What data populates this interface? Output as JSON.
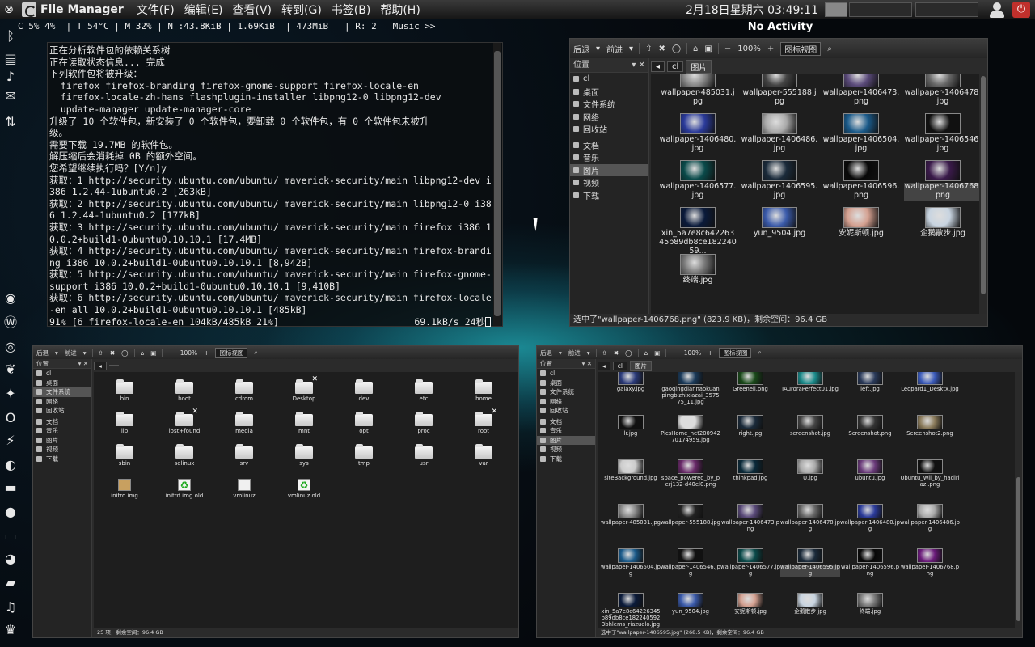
{
  "top_panel": {
    "app_title": "File Manager",
    "menus": [
      "文件(F)",
      "编辑(E)",
      "查看(V)",
      "转到(G)",
      "书签(B)",
      "帮助(H)"
    ],
    "clock": "2月18日星期六 03:49:11"
  },
  "conky": "C 5% 4%  | T 54°C | M 32% | N :43.8KiB | 1.69KiB  | 473MiB   | R: 2   Music >>",
  "now_playing": "No Activity",
  "dock_icons": [
    "bluetooth-icon",
    "network-icon",
    "volume-icon",
    "mail-icon",
    "transfer-icon",
    "firefox-icon",
    "wordpress-icon",
    "chrome-icon",
    "butterfly-icon",
    "star-icon",
    "opera-icon",
    "lightning-icon",
    "fox-icon",
    "clapper-icon",
    "chat-icon",
    "monitor-icon",
    "terminal-icon",
    "folder-icon",
    "music-icon",
    "tooth-icon"
  ],
  "terminal": {
    "lines": [
      "正在分析软件包的依赖关系树",
      "正在读取状态信息... 完成",
      "下列软件包将被升级：",
      "  firefox firefox-branding firefox-gnome-support firefox-locale-en",
      "  firefox-locale-zh-hans flashplugin-installer libpng12-0 libpng12-dev",
      "  update-manager update-manager-core",
      "升级了 10 个软件包，新安装了 0 个软件包，要卸载 0 个软件包，有 0 个软件包未被升",
      "级。",
      "需要下载 19.7MB 的软件包。",
      "解压缩后会消耗掉 0B 的额外空间。",
      "您希望继续执行吗？[Y/n]y",
      "获取：1 http://security.ubuntu.com/ubuntu/ maverick-security/main libpng12-dev i",
      "386 1.2.44-1ubuntu0.2 [263kB]",
      "获取：2 http://security.ubuntu.com/ubuntu/ maverick-security/main libpng12-0 i38",
      "6 1.2.44-1ubuntu0.2 [177kB]",
      "获取：3 http://security.ubuntu.com/ubuntu/ maverick-security/main firefox i386 1",
      "0.0.2+build1-0ubuntu0.10.10.1 [17.4MB]",
      "获取：4 http://security.ubuntu.com/ubuntu/ maverick-security/main firefox-brandi",
      "ng i386 10.0.2+build1-0ubuntu0.10.10.1 [8,942B]",
      "获取：5 http://security.ubuntu.com/ubuntu/ maverick-security/main firefox-gnome-",
      "support i386 10.0.2+build1-0ubuntu0.10.10.1 [9,410B]",
      "获取：6 http://security.ubuntu.com/ubuntu/ maverick-security/main firefox-locale",
      "-en all 10.0.2+build1-0ubuntu0.10.10.1 [485kB]"
    ],
    "progress_left": "91% [6 firefox-locale-en 104kB/485kB 21%]",
    "progress_right": "69.1kB/s 24秒"
  },
  "toolbar": {
    "back": "后退",
    "forward": "前进",
    "zoom": "100%",
    "view_mode": "图标视图"
  },
  "sidebar": {
    "header": "位置",
    "items": [
      "cl",
      "桌面",
      "文件系统",
      "网络",
      "回收站",
      "文档",
      "音乐",
      "图片",
      "视频",
      "下载"
    ]
  },
  "fm1": {
    "crumbs": [
      "cl",
      "图片"
    ],
    "files": [
      {
        "name": "wallpaper-485031.jpg",
        "color": "#888"
      },
      {
        "name": "wallpaper-555188.jpg",
        "color": "#444"
      },
      {
        "name": "wallpaper-1406473.png",
        "color": "#5a4a7a"
      },
      {
        "name": "wallpaper-1406478.jpg",
        "color": "#666"
      },
      {
        "name": "wallpaper-1406480.jpg",
        "color": "#2a3a9a"
      },
      {
        "name": "wallpaper-1406486.jpg",
        "color": "#aaa"
      },
      {
        "name": "wallpaper-1406504.jpg",
        "color": "#1a5a8a"
      },
      {
        "name": "wallpaper-1406546.jpg",
        "color": "#111"
      },
      {
        "name": "wallpaper-1406577.jpg",
        "color": "#0a4a4a"
      },
      {
        "name": "wallpaper-1406595.jpg",
        "color": "#1a2a3a"
      },
      {
        "name": "wallpaper-1406596.png",
        "color": "#080808"
      },
      {
        "name": "wallpaper-1406768.png",
        "color": "#3a1a4a"
      },
      {
        "name": "xin_5a7e8c64226345b89db8ce18224059...",
        "color": "#0a1a3a"
      },
      {
        "name": "yun_9504.jpg",
        "color": "#3a5aaa"
      },
      {
        "name": "安妮斯顿.jpg",
        "color": "#d4a090"
      },
      {
        "name": "企鹅散步.jpg",
        "color": "#c8d4e0"
      },
      {
        "name": "终端.jpg",
        "color": "#777"
      }
    ],
    "status": "选中了\"wallpaper-1406768.png\" (823.9 KB)，剩余空间：96.4 GB"
  },
  "fm2": {
    "crumbs": [
      ""
    ],
    "files": [
      {
        "name": "bin",
        "type": "folder"
      },
      {
        "name": "boot",
        "type": "folder"
      },
      {
        "name": "cdrom",
        "type": "folder"
      },
      {
        "name": "Desktop",
        "type": "folder",
        "badge": "✕"
      },
      {
        "name": "dev",
        "type": "folder"
      },
      {
        "name": "etc",
        "type": "folder"
      },
      {
        "name": "home",
        "type": "folder"
      },
      {
        "name": "lib",
        "type": "folder"
      },
      {
        "name": "lost+found",
        "type": "folder",
        "badge": "✕"
      },
      {
        "name": "media",
        "type": "folder"
      },
      {
        "name": "mnt",
        "type": "folder"
      },
      {
        "name": "opt",
        "type": "folder"
      },
      {
        "name": "proc",
        "type": "folder"
      },
      {
        "name": "root",
        "type": "folder",
        "badge": "✕"
      },
      {
        "name": "sbin",
        "type": "folder"
      },
      {
        "name": "selinux",
        "type": "folder"
      },
      {
        "name": "srv",
        "type": "folder"
      },
      {
        "name": "sys",
        "type": "folder"
      },
      {
        "name": "tmp",
        "type": "folder"
      },
      {
        "name": "usr",
        "type": "folder"
      },
      {
        "name": "var",
        "type": "folder"
      },
      {
        "name": "initrd.img",
        "type": "archive"
      },
      {
        "name": "initrd.img.old",
        "type": "recycle"
      },
      {
        "name": "vmlinuz",
        "type": "doc"
      },
      {
        "name": "vmlinuz.old",
        "type": "recycle"
      }
    ],
    "status": "25 项，剩余空间：96.4 GB"
  },
  "fm3": {
    "crumbs": [
      "cl",
      "图片"
    ],
    "files": [
      {
        "name": "galaxy.jpg",
        "color": "#2a3a7a"
      },
      {
        "name": "gaoqingdiannaokuanpingbizhixiazai_357575_11.jpg",
        "color": "#1a3a5a"
      },
      {
        "name": "Greeneli.png",
        "color": "#1a4a1a"
      },
      {
        "name": "IAuroraPerfect01.jpg",
        "color": "#1a8a8a"
      },
      {
        "name": "left.jpg",
        "color": "#2a3a5a"
      },
      {
        "name": "Leopard1_Desktx.jpg",
        "color": "#3a5aba"
      },
      {
        "name": "lr.jpg",
        "color": "#111"
      },
      {
        "name": "PicsHome_net20094270174959.jpg",
        "color": "#ddd"
      },
      {
        "name": "right.jpg",
        "color": "#1a2a3a"
      },
      {
        "name": "screenshot.jpg",
        "color": "#444"
      },
      {
        "name": "Screenshot.png",
        "color": "#333"
      },
      {
        "name": "Screenshot2.png",
        "color": "#8a7a5a"
      },
      {
        "name": "siteBackground.jpg",
        "color": "#ccc"
      },
      {
        "name": "space_powered_by_perj132-d40el0.png",
        "color": "#6a2a6a"
      },
      {
        "name": "thinkpad.jpg",
        "color": "#0a2a3a"
      },
      {
        "name": "U.jpg",
        "color": "#aaa"
      },
      {
        "name": "ubuntu.jpg",
        "color": "#6a3a7a"
      },
      {
        "name": "Ubuntu_Wil_by_hadiriazi.png",
        "color": "#111"
      },
      {
        "name": "wallpaper-485031.jpg",
        "color": "#888"
      },
      {
        "name": "wallpaper-555188.jpg",
        "color": "#222"
      },
      {
        "name": "wallpaper-1406473.png",
        "color": "#5a4a7a"
      },
      {
        "name": "wallpaper-1406478.jpg",
        "color": "#666"
      },
      {
        "name": "wallpaper-1406480.jpg",
        "color": "#2a3a9a"
      },
      {
        "name": "wallpaper-1406486.jpg",
        "color": "#aaa"
      },
      {
        "name": "wallpaper-1406504.jpg",
        "color": "#1a5a8a"
      },
      {
        "name": "wallpaper-1406546.jpg",
        "color": "#111"
      },
      {
        "name": "wallpaper-1406577.jpg",
        "color": "#0a4a4a"
      },
      {
        "name": "wallpaper-1406595.jpg",
        "color": "#1a2a3a"
      },
      {
        "name": "wallpaper-1406596.png",
        "color": "#080808"
      },
      {
        "name": "wallpaper-1406768.png",
        "color": "#6a1a7a"
      },
      {
        "name": "xin_5a7e8c64226345b89db8ce1822405923bhlems_riazuelo.jpg",
        "color": "#0a1a3a"
      },
      {
        "name": "yun_9504.jpg",
        "color": "#3a5aaa"
      },
      {
        "name": "安妮斯顿.jpg",
        "color": "#d4a090"
      },
      {
        "name": "企鹅散步.jpg",
        "color": "#c8d4e0"
      },
      {
        "name": "终端.jpg",
        "color": "#777"
      }
    ],
    "status": "选中了\"wallpaper-1406595.jpg\" (268.5 KB)，剩余空间：96.4 GB"
  }
}
